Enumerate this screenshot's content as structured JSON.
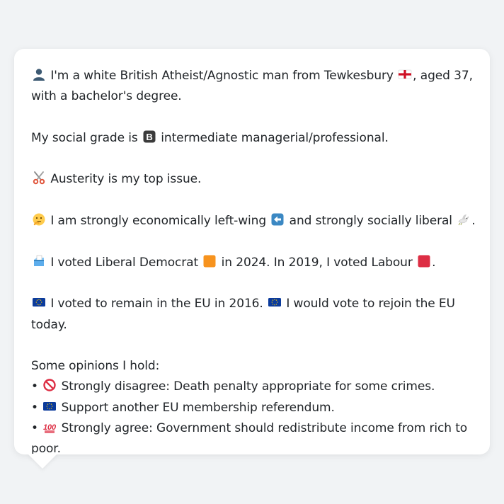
{
  "intro": {
    "part1": "I'm a white British Atheist/Agnostic man from Tewkesbury",
    "part2": ", aged 37, with a bachelor's degree."
  },
  "social_grade": {
    "before": "My social grade is",
    "after": "intermediate managerial/professional."
  },
  "top_issue": {
    "text": "Austerity is my top issue."
  },
  "ideology": {
    "before": "I am strongly economically left-wing",
    "middle": "and strongly socially liberal",
    "after": "."
  },
  "votes": {
    "before": "I voted Liberal Democrat",
    "middle": "in 2024. In 2019, I voted Labour",
    "after": "."
  },
  "eu": {
    "sentence1": "I voted to remain in the EU in 2016.",
    "sentence2": "I would vote to rejoin the EU today."
  },
  "opinions": {
    "heading": "Some opinions I hold:",
    "bullet": "•",
    "items": [
      {
        "icon": "prohibited-icon",
        "text": "Strongly disagree: Death penalty appropriate for some crimes."
      },
      {
        "icon": "eu-flag-icon",
        "text": "Support another EU membership referendum."
      },
      {
        "icon": "hundred-points-icon",
        "text": "Strongly agree: Government should redistribute income from rich to poor."
      }
    ]
  },
  "icons": {
    "person": "bust-in-silhouette-icon",
    "england": "england-flag-icon",
    "grade": "letter-b-icon",
    "scissors": "scissors-icon",
    "thinking": "thinking-face-icon",
    "left_arrow": "left-arrow-icon",
    "dove": "dove-icon",
    "ballot": "ballot-box-icon",
    "orange": "orange-square-icon",
    "red": "red-square-icon",
    "eu": "eu-flag-icon"
  },
  "colors": {
    "background": "#f1f3f5",
    "card": "#ffffff",
    "text": "#212529",
    "libdem_orange": "#f7931e",
    "labour_red": "#dd2e44",
    "eu_blue": "#0b3b9c",
    "eu_star": "#ffcc00"
  }
}
